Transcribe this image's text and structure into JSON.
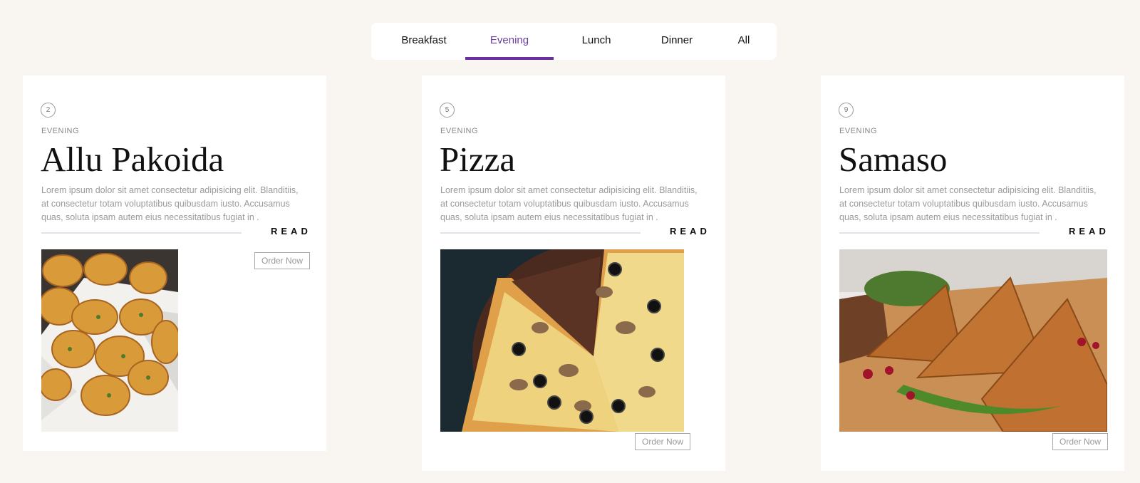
{
  "tabs": [
    {
      "label": "Breakfast"
    },
    {
      "label": "Evening",
      "active": true
    },
    {
      "label": "Lunch"
    },
    {
      "label": "Dinner"
    },
    {
      "label": "All"
    }
  ],
  "accent_color": "#6a2fa0",
  "cards": [
    {
      "number": "2",
      "category": "EVENING",
      "title": "Allu Pakoida",
      "description": "Lorem ipsum dolor sit amet consectetur adipisicing elit. Blanditiis, at consectetur totam voluptatibus quibusdam iusto. Accusamus quas, soluta ipsam autem eius necessitatibus fugiat in .",
      "read_label": "READ",
      "order_label": "Order Now",
      "image": "pakora-photo"
    },
    {
      "number": "5",
      "category": "EVENING",
      "title": "Pizza",
      "description": "Lorem ipsum dolor sit amet consectetur adipisicing elit. Blanditiis, at consectetur totam voluptatibus quibusdam iusto. Accusamus quas, soluta ipsam autem eius necessitatibus fugiat in .",
      "read_label": "READ",
      "order_label": "Order Now",
      "image": "pizza-photo"
    },
    {
      "number": "9",
      "category": "EVENING",
      "title": "Samaso",
      "description": "Lorem ipsum dolor sit amet consectetur adipisicing elit. Blanditiis, at consectetur totam voluptatibus quibusdam iusto. Accusamus quas, soluta ipsam autem eius necessitatibus fugiat in .",
      "read_label": "READ",
      "order_label": "Order Now",
      "image": "samosa-photo"
    }
  ]
}
